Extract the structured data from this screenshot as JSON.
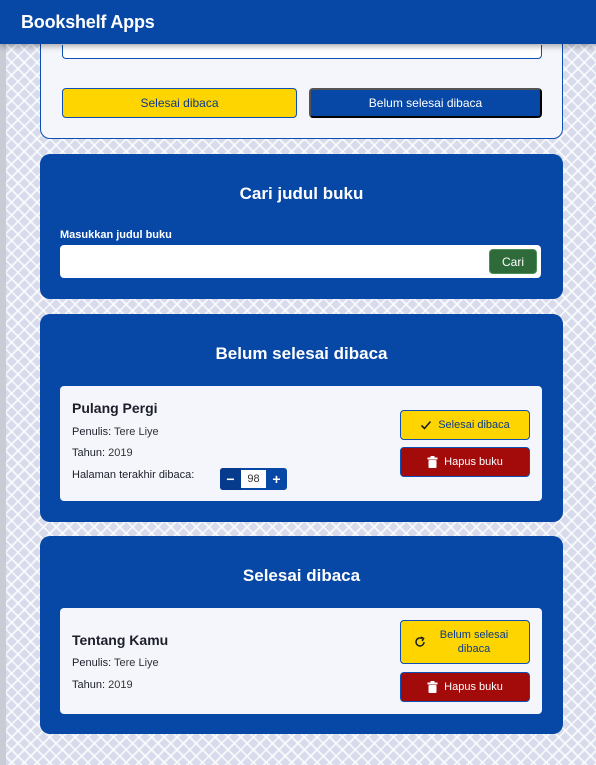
{
  "header": {
    "title": "Bookshelf Apps"
  },
  "form": {
    "finished_button": "Selesai dibaca",
    "unfinished_button": "Belum selesai dibaca"
  },
  "search": {
    "heading": "Cari judul buku",
    "label": "Masukkan judul buku",
    "input_value": "",
    "button": "Cari"
  },
  "unread_shelf": {
    "heading": "Belum selesai dibaca",
    "books": [
      {
        "title": "Pulang Pergi",
        "author_label": "Penulis:",
        "author": "Tere Liye",
        "year_label": "Tahun:",
        "year": "2019",
        "page_label": "Halaman terakhir dibaca:",
        "page": "98",
        "minus": "−",
        "plus": "+",
        "action_button": "Selesai dibaca",
        "delete_button": "Hapus buku"
      }
    ]
  },
  "read_shelf": {
    "heading": "Selesai dibaca",
    "books": [
      {
        "title": "Tentang Kamu",
        "author_label": "Penulis:",
        "author": "Tere Liye",
        "year_label": "Tahun:",
        "year": "2019",
        "action_button": "Belum selesai dibaca",
        "delete_button": "Hapus buku"
      }
    ]
  },
  "colors": {
    "primary": "#0747a6",
    "accent_yellow": "#ffd500",
    "danger": "#a30b0b",
    "search_green": "#2f6b3a"
  },
  "icons": {
    "finish": "check-icon",
    "undo": "refresh-icon",
    "delete": "trash-icon"
  }
}
